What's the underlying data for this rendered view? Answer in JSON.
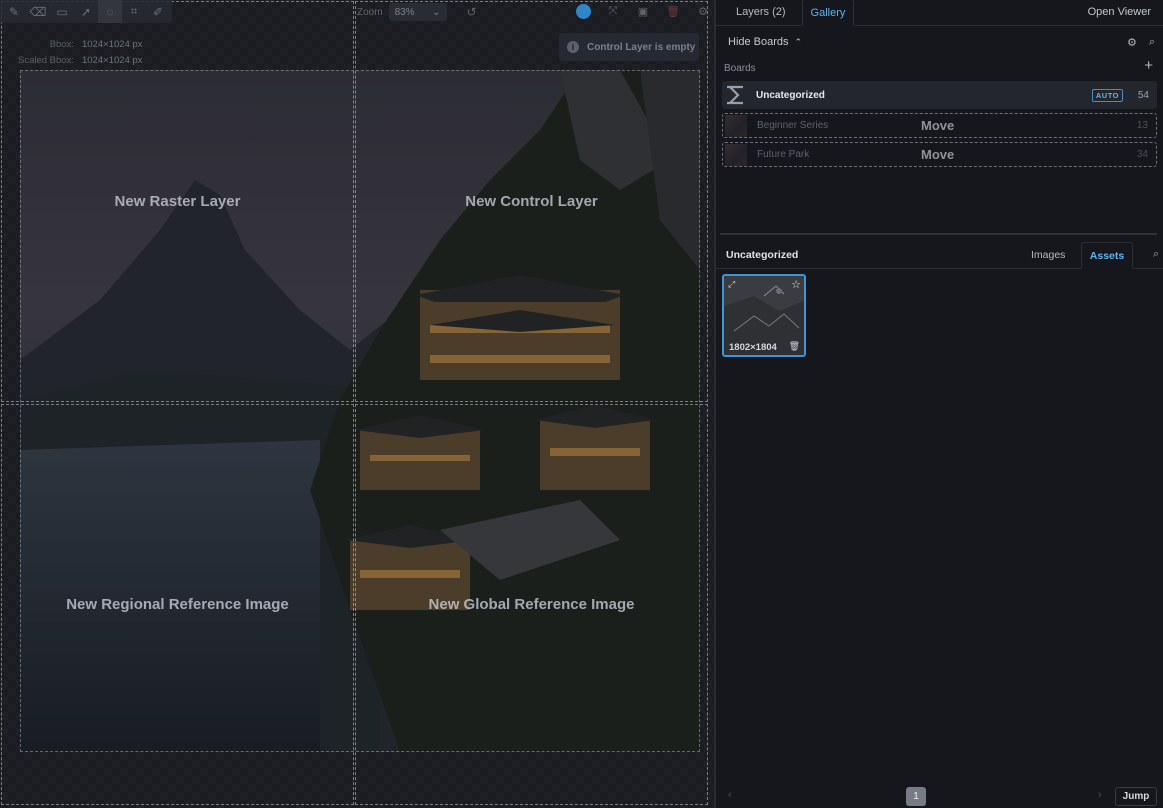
{
  "canvas": {
    "zoom_label": "Zoom",
    "zoom_value": "83%",
    "bbox_label": "Bbox:",
    "bbox_value": "1024×1024 px",
    "scaled_bbox_label": "Scaled Bbox:",
    "scaled_bbox_value": "1024×1024 px",
    "toast_text": "Control Layer is empty",
    "drop_targets": [
      "New Raster Layer",
      "New Control Layer",
      "New Regional Reference Image",
      "New Global Reference Image"
    ],
    "tools": [
      "brush-icon",
      "eraser-icon",
      "rect-icon",
      "move-icon",
      "view-icon",
      "bbox-icon",
      "colorpicker-icon"
    ]
  },
  "panel": {
    "tabs": [
      "Layers (2)",
      "Gallery"
    ],
    "active_tab": "Gallery",
    "open_viewer": "Open Viewer",
    "hide_boards": "Hide Boards",
    "boards_label": "Boards",
    "boards": [
      {
        "name": "Uncategorized",
        "count": "54",
        "badge": "AUTO",
        "selected": true
      },
      {
        "name": "Beginner Series",
        "count": "13",
        "drop_label": "Move"
      },
      {
        "name": "Future Park",
        "count": "34",
        "drop_label": "Move"
      }
    ],
    "gallery_title": "Uncategorized",
    "gallery_tabs": [
      "Images",
      "Assets"
    ],
    "active_gallery_tab": "Assets",
    "asset": {
      "dims": "1802×1804"
    },
    "pager": {
      "page": "1",
      "jump": "Jump"
    }
  },
  "colors": {
    "accent": "#5fb3f0",
    "selection_border": "#3f95d6"
  }
}
